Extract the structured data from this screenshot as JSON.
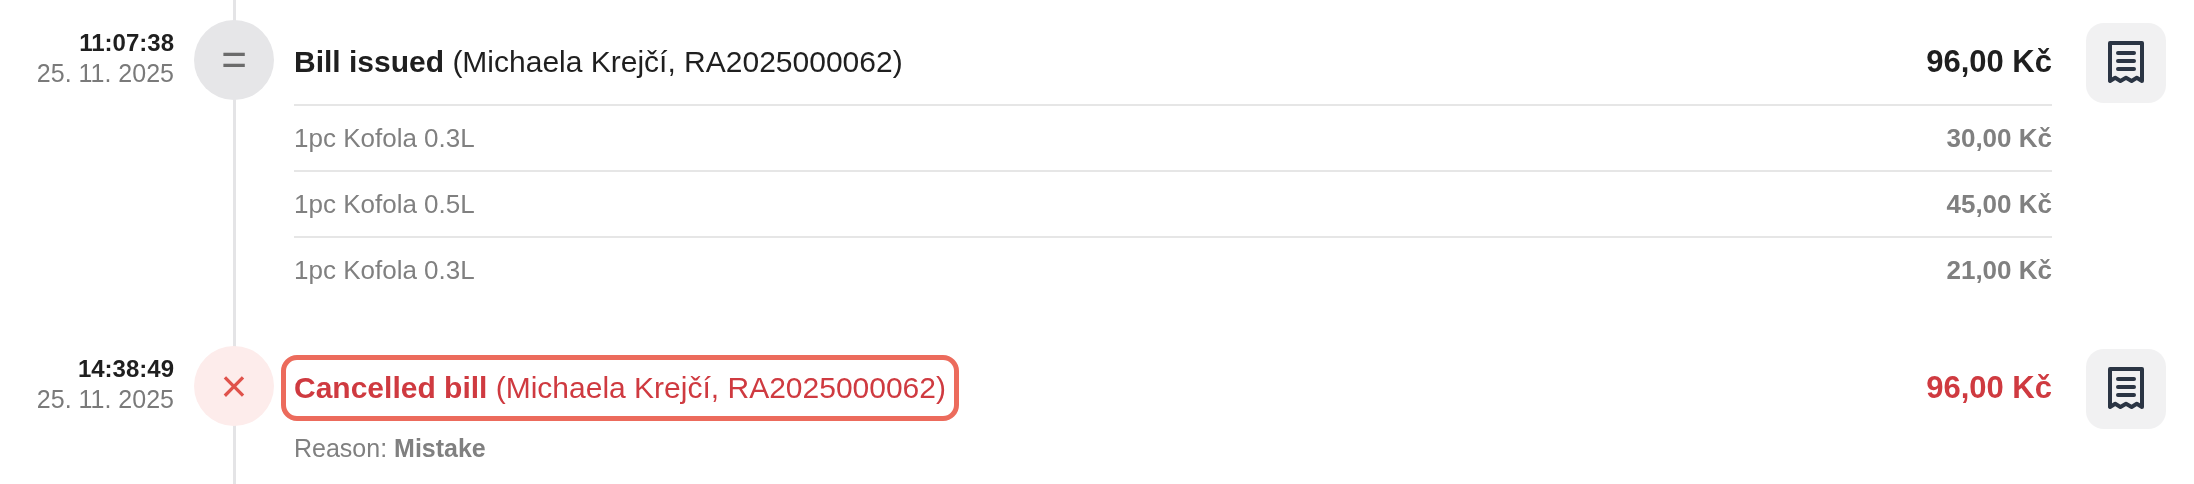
{
  "events": [
    {
      "kind": "issued",
      "time": "11:07:38",
      "date": "25. 11. 2025",
      "icon_char": "=",
      "title": "**Bill issued** (Michaela Krejčí, RA2025000062)",
      "highlighted": false,
      "amount": "96,00 Kč",
      "items": [
        {
          "name": "1pc Kofola 0.3L",
          "price": "30,00 Kč"
        },
        {
          "name": "1pc Kofola 0.5L",
          "price": "45,00 Kč"
        },
        {
          "name": "1pc Kofola 0.3L",
          "price": "21,00 Kč"
        }
      ]
    },
    {
      "kind": "cancelled",
      "time": "14:38:49",
      "date": "25. 11. 2025",
      "icon_char": "×",
      "title": "**Cancelled bill** (Michaela Krejčí, RA2025000062)",
      "highlighted": true,
      "amount": "96,00 Kč",
      "reason": "Reason: **Mistake**"
    }
  ]
}
